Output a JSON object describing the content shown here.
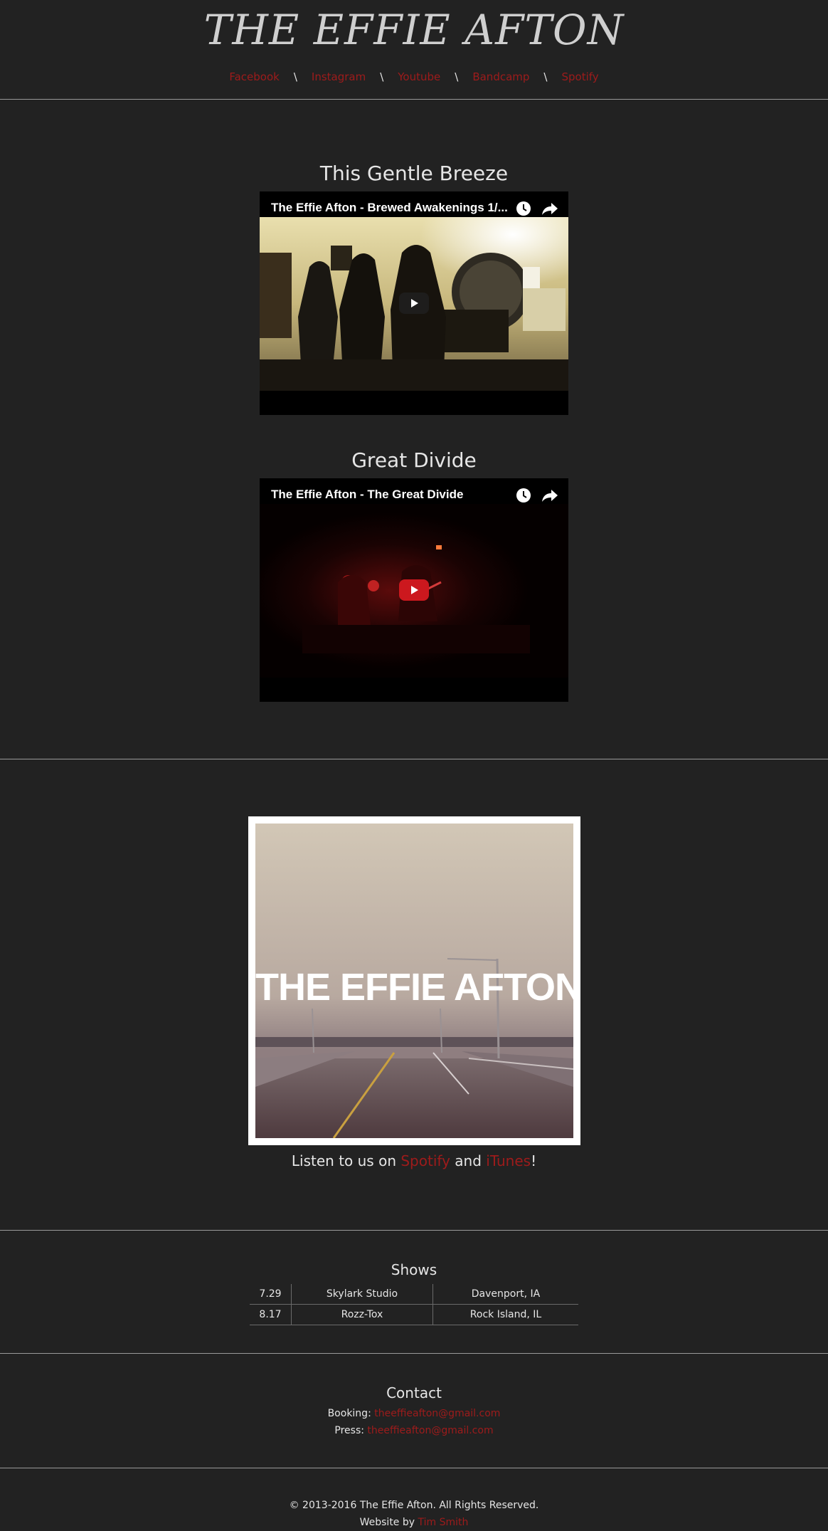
{
  "site": {
    "title": "THE EFFIE AFTON"
  },
  "nav": {
    "separator": "\\",
    "items": [
      {
        "label": "Facebook"
      },
      {
        "label": "Instagram"
      },
      {
        "label": "Youtube"
      },
      {
        "label": "Bandcamp"
      },
      {
        "label": "Spotify"
      }
    ]
  },
  "videos": [
    {
      "heading": "This Gentle Breeze",
      "title": "The Effie Afton - Brewed Awakenings 1/...",
      "icons": [
        "watch-later-icon",
        "share-icon",
        "play-icon"
      ]
    },
    {
      "heading": "Great Divide",
      "title": "The Effie Afton - The Great Divide",
      "icons": [
        "watch-later-icon",
        "share-icon",
        "play-icon"
      ]
    }
  ],
  "album": {
    "cover_text": "THE EFFIE AFTON"
  },
  "listen": {
    "prefix": "Listen to us on ",
    "spotify": "Spotify",
    "middle": " and ",
    "itunes": "iTunes",
    "suffix": "!"
  },
  "shows": {
    "title": "Shows",
    "rows": [
      {
        "date": "7.29",
        "venue": "Skylark Studio",
        "city": "Davenport, IA"
      },
      {
        "date": "8.17",
        "venue": "Rozz-Tox",
        "city": "Rock Island, IL"
      }
    ]
  },
  "contact": {
    "title": "Contact",
    "booking_label": "Booking: ",
    "booking_email": "theeffieafton@gmail.com",
    "press_label": "Press: ",
    "press_email": "theeffieafton@gmail.com"
  },
  "footer": {
    "copyright": "© 2013-2016 The Effie Afton. All Rights Reserved.",
    "credit_label": "Website by ",
    "credit_name": "Tim Smith"
  },
  "colors": {
    "background": "#222222",
    "link": "#9e1b1b",
    "text": "#e6e6e6",
    "youtube_red": "#cc181e"
  }
}
